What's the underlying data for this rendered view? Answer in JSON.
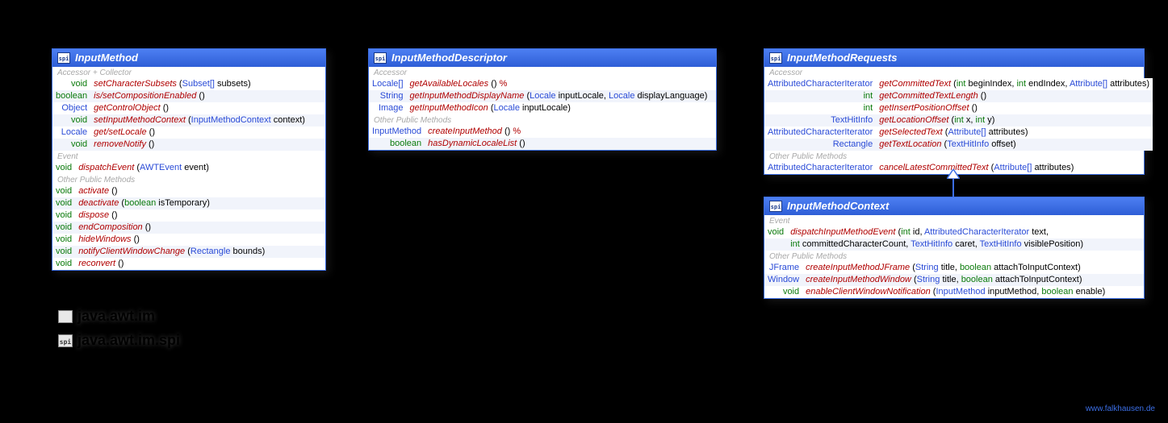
{
  "footer_link": "www.falkhausen.de",
  "packages": [
    "java.awt.im",
    "java.awt.im.spi"
  ],
  "classes": {
    "im": {
      "title": "InputMethod",
      "sections": [
        {
          "label": "Accessor + Collector",
          "rows": [
            {
              "ret": "void",
              "name": "setCharacterSubsets",
              "args": [
                {
                  "t": "Subset[]",
                  "n": "subsets"
                }
              ]
            },
            {
              "ret": "boolean",
              "name": "is/setCompositionEnabled",
              "args": []
            },
            {
              "ret": "Object",
              "name": "getControlObject",
              "args": []
            },
            {
              "ret": "void",
              "name": "setInputMethodContext",
              "args": [
                {
                  "t": "InputMethodContext",
                  "n": "context"
                }
              ]
            },
            {
              "ret": "Locale",
              "name": "get/setLocale",
              "args": []
            },
            {
              "ret": "void",
              "name": "removeNotify",
              "args": []
            }
          ]
        },
        {
          "label": "Event",
          "rows": [
            {
              "ret": "void",
              "name": "dispatchEvent",
              "args": [
                {
                  "t": "AWTEvent",
                  "n": "event"
                }
              ]
            }
          ]
        },
        {
          "label": "Other Public Methods",
          "rows": [
            {
              "ret": "void",
              "name": "activate",
              "args": []
            },
            {
              "ret": "void",
              "name": "deactivate",
              "args": [
                {
                  "t": "boolean",
                  "n": "isTemporary"
                }
              ]
            },
            {
              "ret": "void",
              "name": "dispose",
              "args": []
            },
            {
              "ret": "void",
              "name": "endComposition",
              "args": []
            },
            {
              "ret": "void",
              "name": "hideWindows",
              "args": []
            },
            {
              "ret": "void",
              "name": "notifyClientWindowChange",
              "args": [
                {
                  "t": "Rectangle",
                  "n": "bounds"
                }
              ]
            },
            {
              "ret": "void",
              "name": "reconvert",
              "args": []
            }
          ]
        }
      ]
    },
    "imd": {
      "title": "InputMethodDescriptor",
      "sections": [
        {
          "label": "Accessor",
          "rows": [
            {
              "ret": "Locale[]",
              "name": "getAvailableLocales",
              "args": [],
              "suffix": "%"
            },
            {
              "ret": "String",
              "name": "getInputMethodDisplayName",
              "args": [
                {
                  "t": "Locale",
                  "n": "inputLocale"
                },
                {
                  "t": "Locale",
                  "n": "displayLanguage"
                }
              ]
            },
            {
              "ret": "Image",
              "name": "getInputMethodIcon",
              "args": [
                {
                  "t": "Locale",
                  "n": "inputLocale"
                }
              ]
            }
          ]
        },
        {
          "label": "Other Public Methods",
          "rows": [
            {
              "ret": "InputMethod",
              "name": "createInputMethod",
              "args": [],
              "suffix": "%"
            },
            {
              "ret": "boolean",
              "name": "hasDynamicLocaleList",
              "args": []
            }
          ]
        }
      ]
    },
    "imr": {
      "title": "InputMethodRequests",
      "sections": [
        {
          "label": "Accessor",
          "rows": [
            {
              "ret": "AttributedCharacterIterator",
              "name": "getCommittedText",
              "args": [
                {
                  "t": "int",
                  "n": "beginIndex"
                },
                {
                  "t": "int",
                  "n": "endIndex"
                },
                {
                  "t": "Attribute[]",
                  "n": "attributes"
                }
              ]
            },
            {
              "ret": "int",
              "name": "getCommittedTextLength",
              "args": []
            },
            {
              "ret": "int",
              "name": "getInsertPositionOffset",
              "args": []
            },
            {
              "ret": "TextHitInfo",
              "name": "getLocationOffset",
              "args": [
                {
                  "t": "int",
                  "n": "x"
                },
                {
                  "t": "int",
                  "n": "y"
                }
              ]
            },
            {
              "ret": "AttributedCharacterIterator",
              "name": "getSelectedText",
              "args": [
                {
                  "t": "Attribute[]",
                  "n": "attributes"
                }
              ]
            },
            {
              "ret": "Rectangle",
              "name": "getTextLocation",
              "args": [
                {
                  "t": "TextHitInfo",
                  "n": "offset"
                }
              ]
            }
          ]
        },
        {
          "label": "Other Public Methods",
          "rows": [
            {
              "ret": "AttributedCharacterIterator",
              "name": "cancelLatestCommittedText",
              "args": [
                {
                  "t": "Attribute[]",
                  "n": "attributes"
                }
              ]
            }
          ]
        }
      ]
    },
    "imc": {
      "title": "InputMethodContext",
      "sections": [
        {
          "label": "Event",
          "rows": [
            {
              "ret": "void",
              "name": "dispatchInputMethodEvent",
              "args": [
                {
                  "t": "int",
                  "n": "id"
                },
                {
                  "t": "AttributedCharacterIterator",
                  "n": "text"
                }
              ],
              "cont": true
            },
            {
              "ret": "",
              "name": "",
              "args": [
                {
                  "t": "int",
                  "n": "committedCharacterCount"
                },
                {
                  "t": "TextHitInfo",
                  "n": "caret"
                },
                {
                  "t": "TextHitInfo",
                  "n": "visiblePosition"
                }
              ],
              "contRow": true
            }
          ]
        },
        {
          "label": "Other Public Methods",
          "rows": [
            {
              "ret": "JFrame",
              "name": "createInputMethodJFrame",
              "args": [
                {
                  "t": "String",
                  "n": "title"
                },
                {
                  "t": "boolean",
                  "n": "attachToInputContext"
                }
              ]
            },
            {
              "ret": "Window",
              "name": "createInputMethodWindow",
              "args": [
                {
                  "t": "String",
                  "n": "title"
                },
                {
                  "t": "boolean",
                  "n": "attachToInputContext"
                }
              ]
            },
            {
              "ret": "void",
              "name": "enableClientWindowNotification",
              "args": [
                {
                  "t": "InputMethod",
                  "n": "inputMethod"
                },
                {
                  "t": "boolean",
                  "n": "enable"
                }
              ]
            }
          ]
        }
      ]
    }
  }
}
